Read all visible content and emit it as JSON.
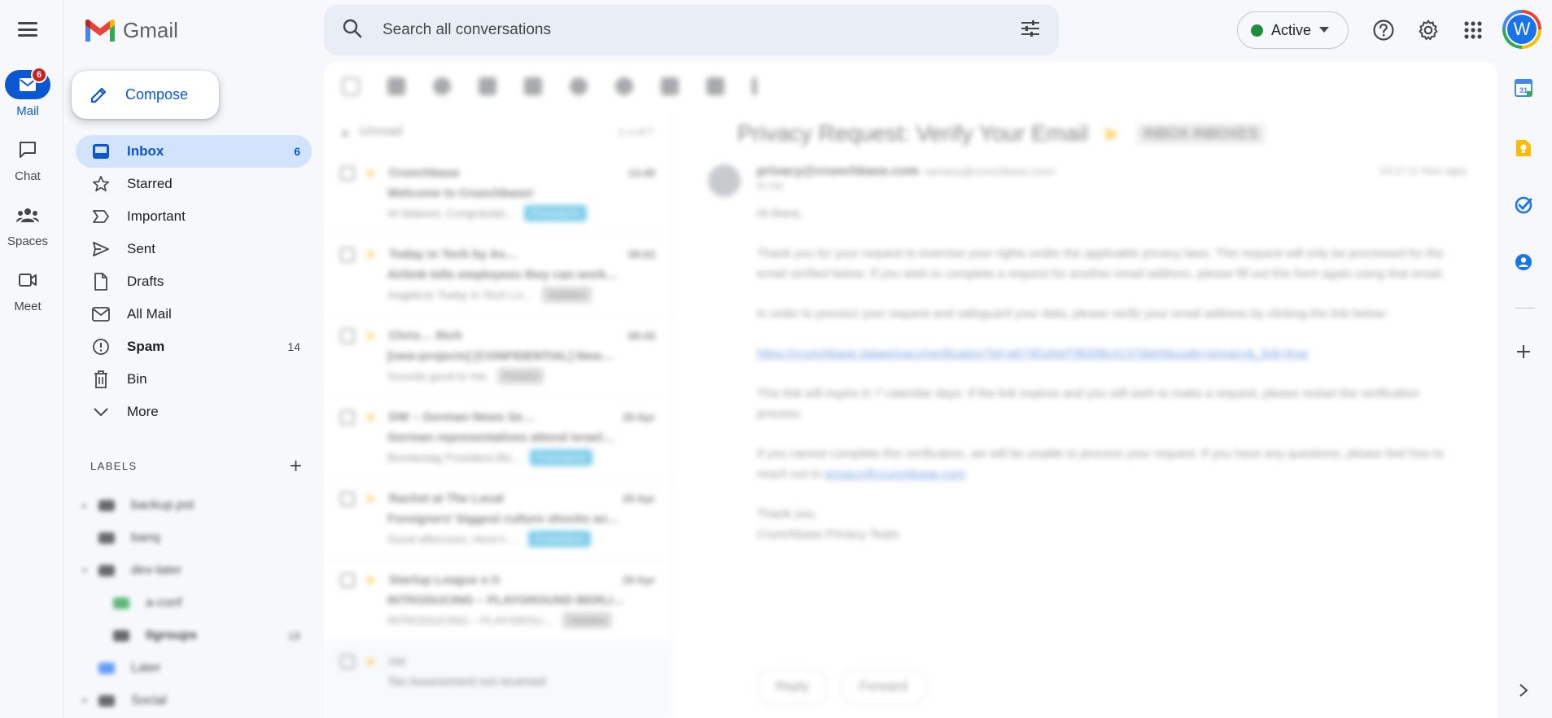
{
  "rail": {
    "items": [
      {
        "label": "Mail",
        "badge": "6"
      },
      {
        "label": "Chat"
      },
      {
        "label": "Spaces"
      },
      {
        "label": "Meet"
      }
    ]
  },
  "app": {
    "name": "Gmail"
  },
  "compose": {
    "label": "Compose"
  },
  "search": {
    "placeholder": "Search all conversations"
  },
  "status": {
    "label": "Active",
    "color": "#1e8e3e"
  },
  "account": {
    "initial": "W"
  },
  "nav": {
    "items": [
      {
        "label": "Inbox",
        "count": "6",
        "icon": "inbox-icon"
      },
      {
        "label": "Starred",
        "count": "",
        "icon": "star-icon"
      },
      {
        "label": "Important",
        "count": "",
        "icon": "important-icon"
      },
      {
        "label": "Sent",
        "count": "",
        "icon": "send-icon"
      },
      {
        "label": "Drafts",
        "count": "",
        "icon": "draft-icon"
      },
      {
        "label": "All Mail",
        "count": "",
        "icon": "mail-icon"
      },
      {
        "label": "Spam",
        "count": "14",
        "icon": "spam-icon"
      },
      {
        "label": "Bin",
        "count": "",
        "icon": "trash-icon"
      },
      {
        "label": "More",
        "count": "",
        "icon": "chevron-down-icon"
      }
    ]
  },
  "labels": {
    "title": "LABELS",
    "items": [
      {
        "name": "backup.pst",
        "count": "",
        "color": "#444746"
      },
      {
        "name": "banq",
        "count": "",
        "color": "#444746"
      },
      {
        "name": "dev-later",
        "count": "",
        "color": "#444746"
      },
      {
        "name": "a-conf",
        "count": "",
        "color": "#34a853"
      },
      {
        "name": "0groups",
        "count": "18",
        "color": "#444746"
      },
      {
        "name": "Later",
        "count": "",
        "color": "#4285f4"
      },
      {
        "name": "Social",
        "count": "",
        "color": "#444746"
      }
    ]
  },
  "list": {
    "header": "Unread",
    "range": "1–1 of 7",
    "rows": [
      {
        "sender": "Crunchbase",
        "date": "13:49",
        "subject": "Welcome to Crunchbase!",
        "snippet": "Hi Waleed, Congratulat…",
        "chip": "Promotions",
        "chip_grey": false,
        "read": false
      },
      {
        "sender": "Today in Tech by As…",
        "date": "09:03",
        "subject": "Airbnb tells employees they can work…",
        "snippet": "Angelica! Today in Tech Lo…",
        "chip": "Updates",
        "chip_grey": true,
        "read": false
      },
      {
        "sender": "Chris… Rich",
        "date": "08:43",
        "subject": "[new-projects] [CONFIDENTIAL] New…",
        "snippet": "Sounds good to me.",
        "chip": "Forums",
        "chip_grey": true,
        "read": false
      },
      {
        "sender": "DW – German News Se…",
        "date": "29 Apr",
        "subject": "German representatives attend Israel…",
        "snippet": "Bundestag President Bä…",
        "chip": "Promotions",
        "chip_grey": false,
        "read": false
      },
      {
        "sender": "Rachel at The Local",
        "date": "29 Apr",
        "subject": "Foreigners' biggest culture shocks an…",
        "snippet": "Good afternoon, Here's …",
        "chip": "Promotions",
        "chip_grey": false,
        "read": false
      },
      {
        "sender": "Startup League e.V.",
        "date": "29 Apr",
        "subject": "INTRODUCING – PLAYGROUND BERLI…",
        "snippet": "INTRODUCING – PLAYGROU…",
        "chip": "Updates",
        "chip_grey": true,
        "read": false
      },
      {
        "sender": "me",
        "date": "",
        "subject": "Tax Assessment not received",
        "snippet": "",
        "chip": "",
        "chip_grey": true,
        "read": true
      }
    ]
  },
  "reader": {
    "subject": "Privacy Request: Verify Your Email",
    "tag": "INBOX INBOXES",
    "sender": "privacy@crunchbase.com",
    "sender_email": "<privacy@crunchbase.com>",
    "to": "to me",
    "time": "13:17 (1 hour ago)",
    "greeting": "Hi there,",
    "p1": "Thank you for your request to exercise your rights under the applicable privacy laws. This request will only be processed for the email verified below. If you wish to complete a request for another email address, please fill out this form again using that email.",
    "p2": "In order to process your request and safeguard your data, please verify your email address by clicking the link below:",
    "link": "https://crunchbase.dataprivacy/verification?id=a673f1d4ef7805f8c4137da93&code=privacy&_link=true",
    "p3": "This link will expire in 7 calendar days. If the link expires and you still wish to make a request, please restart the verification process.",
    "p4": "If you cannot complete this verification, we will be unable to process your request. If you have any questions, please feel free to reach out to",
    "p4_link": "privacy@crunchbase.com",
    "sign1": "Thank you,",
    "sign2": "Crunchbase Privacy Team",
    "reply": "Reply",
    "forward": "Forward"
  }
}
